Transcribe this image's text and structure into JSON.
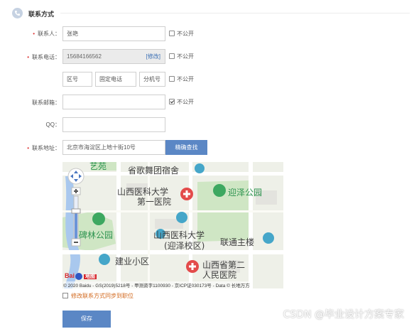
{
  "section": {
    "title": "联系方式",
    "icon": "phone-icon"
  },
  "form": {
    "contact": {
      "label": "联系人：",
      "value": "张艳",
      "private_label": "不公开",
      "private_checked": false
    },
    "phone": {
      "label": "联系电话：",
      "value": "15684166562",
      "modify_label": "[修改]",
      "private_label": "不公开",
      "private_checked": false
    },
    "landline": {
      "area_placeholder": "区号",
      "number_placeholder": "固定电话",
      "ext_placeholder": "分机号",
      "private_label": "不公开",
      "private_checked": false
    },
    "email": {
      "label": "联系邮箱：",
      "value": "",
      "private_label": "不公开",
      "private_checked": true
    },
    "qq": {
      "label": "QQ：",
      "value": ""
    },
    "address": {
      "label": "联系地址：",
      "value": "北京市海淀区上地十街10号",
      "search_label": "精确查找"
    }
  },
  "map": {
    "labels": {
      "top_garden": "艺苑",
      "dorm": "省歌舞团宿舍",
      "hospital1_line1": "山西医科大学",
      "hospital1_line2": "第一医院",
      "yingze_park": "迎泽公园",
      "bilin_park": "碑林公园",
      "univ_line1": "山西医科大学",
      "univ_line2": "(迎泽校区)",
      "lianda": "联通主楼",
      "jianye": "建业小区",
      "hospital2_line1": "山西省第二",
      "hospital2_line2": "人民医院"
    },
    "logo_text": "Bai",
    "logo_suffix": "地图",
    "copyright": "© 2020 Baidu - GS(2019)5218号 - 甲测资字1100930 - 京ICP证030173号 - Data © 长地万方"
  },
  "sync_label": "修改联系方式同步到职位",
  "save_label": "保存",
  "watermark": "CSDN @毕业设计方案专家",
  "colors": {
    "accent": "#5b87c5",
    "required": "#d33333",
    "link": "#3a6fb5",
    "sync": "#d2691e"
  }
}
